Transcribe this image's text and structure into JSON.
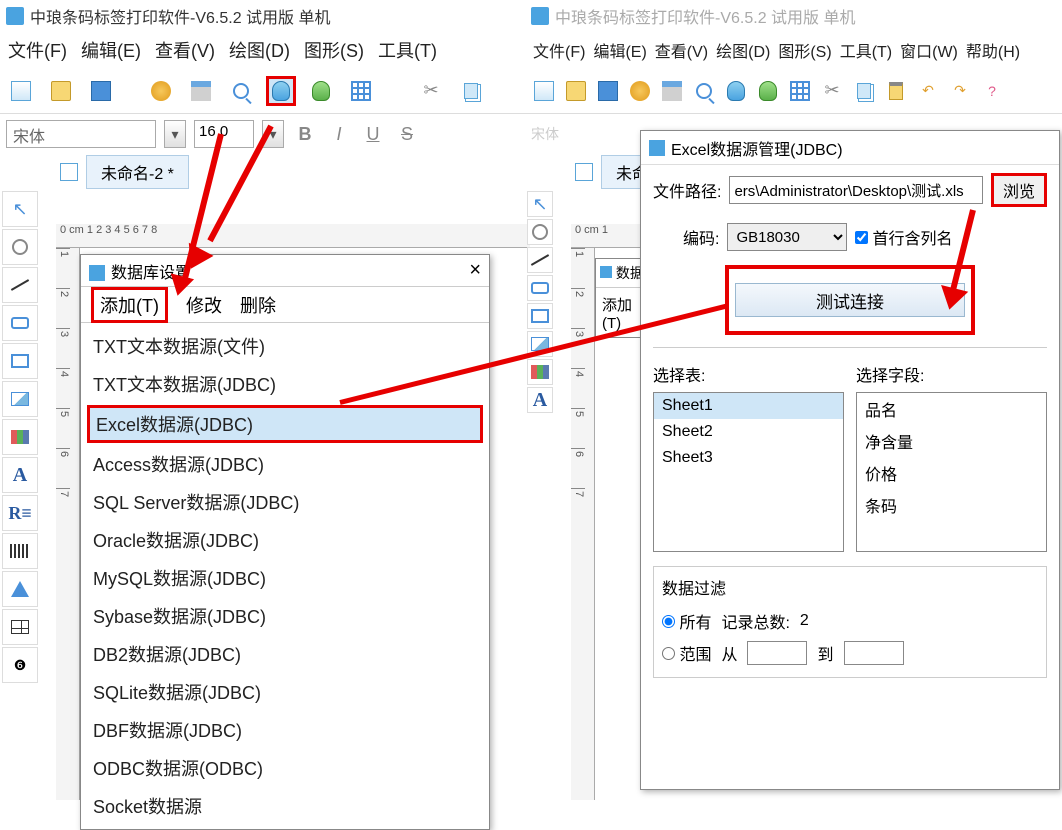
{
  "left": {
    "title": "中琅条码标签打印软件-V6.5.2 试用版 单机",
    "menu": {
      "file": "文件(F)",
      "edit": "编辑(E)",
      "view": "查看(V)",
      "draw": "绘图(D)",
      "shape": "图形(S)",
      "tool": "工具(T)"
    },
    "font_name": "宋体",
    "font_size": "16 0",
    "doc_tab": "未命名-2 *",
    "ruler": "0 cm 1     2        3        4        5        6        7        8",
    "popup": {
      "title": "数据库设置",
      "add": "添加(T)",
      "edit": "修改",
      "del": "删除",
      "items": [
        "TXT文本数据源(文件)",
        "TXT文本数据源(JDBC)",
        "Excel数据源(JDBC)",
        "Access数据源(JDBC)",
        "SQL Server数据源(JDBC)",
        "Oracle数据源(JDBC)",
        "MySQL数据源(JDBC)",
        "Sybase数据源(JDBC)",
        "DB2数据源(JDBC)",
        "SQLite数据源(JDBC)",
        "DBF数据源(JDBC)",
        "ODBC数据源(ODBC)",
        "Socket数据源"
      ]
    }
  },
  "right": {
    "title": "中琅条码标签打印软件-V6.5.2 试用版 单机",
    "menu": {
      "file": "文件(F)",
      "edit": "编辑(E)",
      "view": "查看(V)",
      "draw": "绘图(D)",
      "shape": "图形(S)",
      "tool": "工具(T)",
      "window": "窗口(W)",
      "help": "帮助(H)"
    },
    "doc_tab": "未命名",
    "popup_add": "添加(T)",
    "popup_title": "数据"
  },
  "excel": {
    "title": "Excel数据源管理(JDBC)",
    "path_label": "文件路径:",
    "path_value": "ers\\Administrator\\Desktop\\测试.xls",
    "browse": "浏览",
    "enc_label": "编码:",
    "enc_value": "GB18030",
    "firstrow": "首行含列名",
    "test": "测试连接",
    "tbl_label": "选择表:",
    "fld_label": "选择字段:",
    "sheets": [
      "Sheet1",
      "Sheet2",
      "Sheet3"
    ],
    "fields": [
      "品名",
      "净含量",
      "价格",
      "条码"
    ],
    "filter": {
      "title": "数据过滤",
      "all": "所有",
      "total_label": "记录总数:",
      "total": "2",
      "range": "范围",
      "from": "从",
      "to": "到"
    }
  }
}
